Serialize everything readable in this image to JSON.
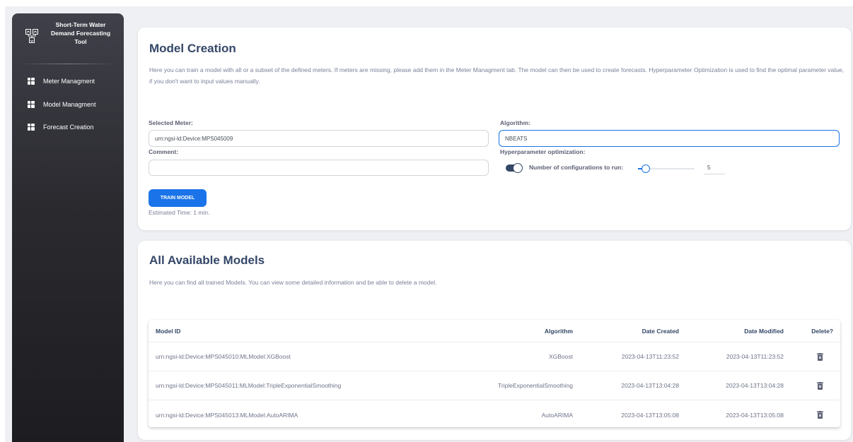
{
  "sidebar": {
    "title": "Short-Term Water\nDemand Forecasting\nTool",
    "items": [
      {
        "label": "Meter Managment",
        "icon": "dashboard-icon"
      },
      {
        "label": "Model Managment",
        "icon": "dashboard-icon"
      },
      {
        "label": "Forecast Creation",
        "icon": "dashboard-icon"
      }
    ]
  },
  "model_creation": {
    "title": "Model Creation",
    "description": "Here you can train a model with all or a subset of the defined meters. If meters are missing, please add them in the Meter Managment tab. The model can then be used to create forecasts. Hyperparameter Optimization is used to find the optimal parameter value, if you don't want to input values manually.",
    "selected_meter_label": "Selected Meter:",
    "selected_meter_value": "urn:ngsi-ld:Device:MPS045009",
    "comment_label": "Comment:",
    "comment_value": "",
    "algorithm_label": "Algorithm:",
    "algorithm_value": "NBEATS",
    "hyperparameter_label": "Hyperparameter optimization:",
    "hyperparameter_enabled": true,
    "configurations_label": "Number of configurations to run:",
    "configurations_value": "5",
    "configurations_slider_fraction": 0.08,
    "train_button_label": "TRAIN MODEL",
    "estimated_time": "Estimated Time: 1 min."
  },
  "models": {
    "title": "All Available Models",
    "description": "Here you can find all trained Models. You can view some detailed information and be able to delete a model.",
    "columns": {
      "id": "Model ID",
      "algorithm": "Algorithm",
      "created": "Date Created",
      "modified": "Date Modified",
      "delete": "Delete?"
    },
    "rows": [
      {
        "id": "urn:ngsi-ld:Device:MPS045010:MLModel:XGBoost",
        "algorithm": "XGBoost",
        "created": "2023-04-13T11:23:52",
        "modified": "2023-04-13T11:23:52"
      },
      {
        "id": "urn:ngsi-ld:Device:MPS045011:MLModel:TripleExponentialSmoothing",
        "algorithm": "TripleExponentialSmoothing",
        "created": "2023-04-13T13:04:28",
        "modified": "2023-04-13T13:04:28"
      },
      {
        "id": "urn:ngsi-ld:Device:MPS045013:MLModel:AutoARIMA",
        "algorithm": "AutoARIMA",
        "created": "2023-04-13T13:05:08",
        "modified": "2023-04-13T13:05:08"
      }
    ]
  },
  "colors": {
    "accent": "#1a73e8",
    "heading": "#344767",
    "muted": "#7b809a",
    "background": "#eef0f3"
  }
}
